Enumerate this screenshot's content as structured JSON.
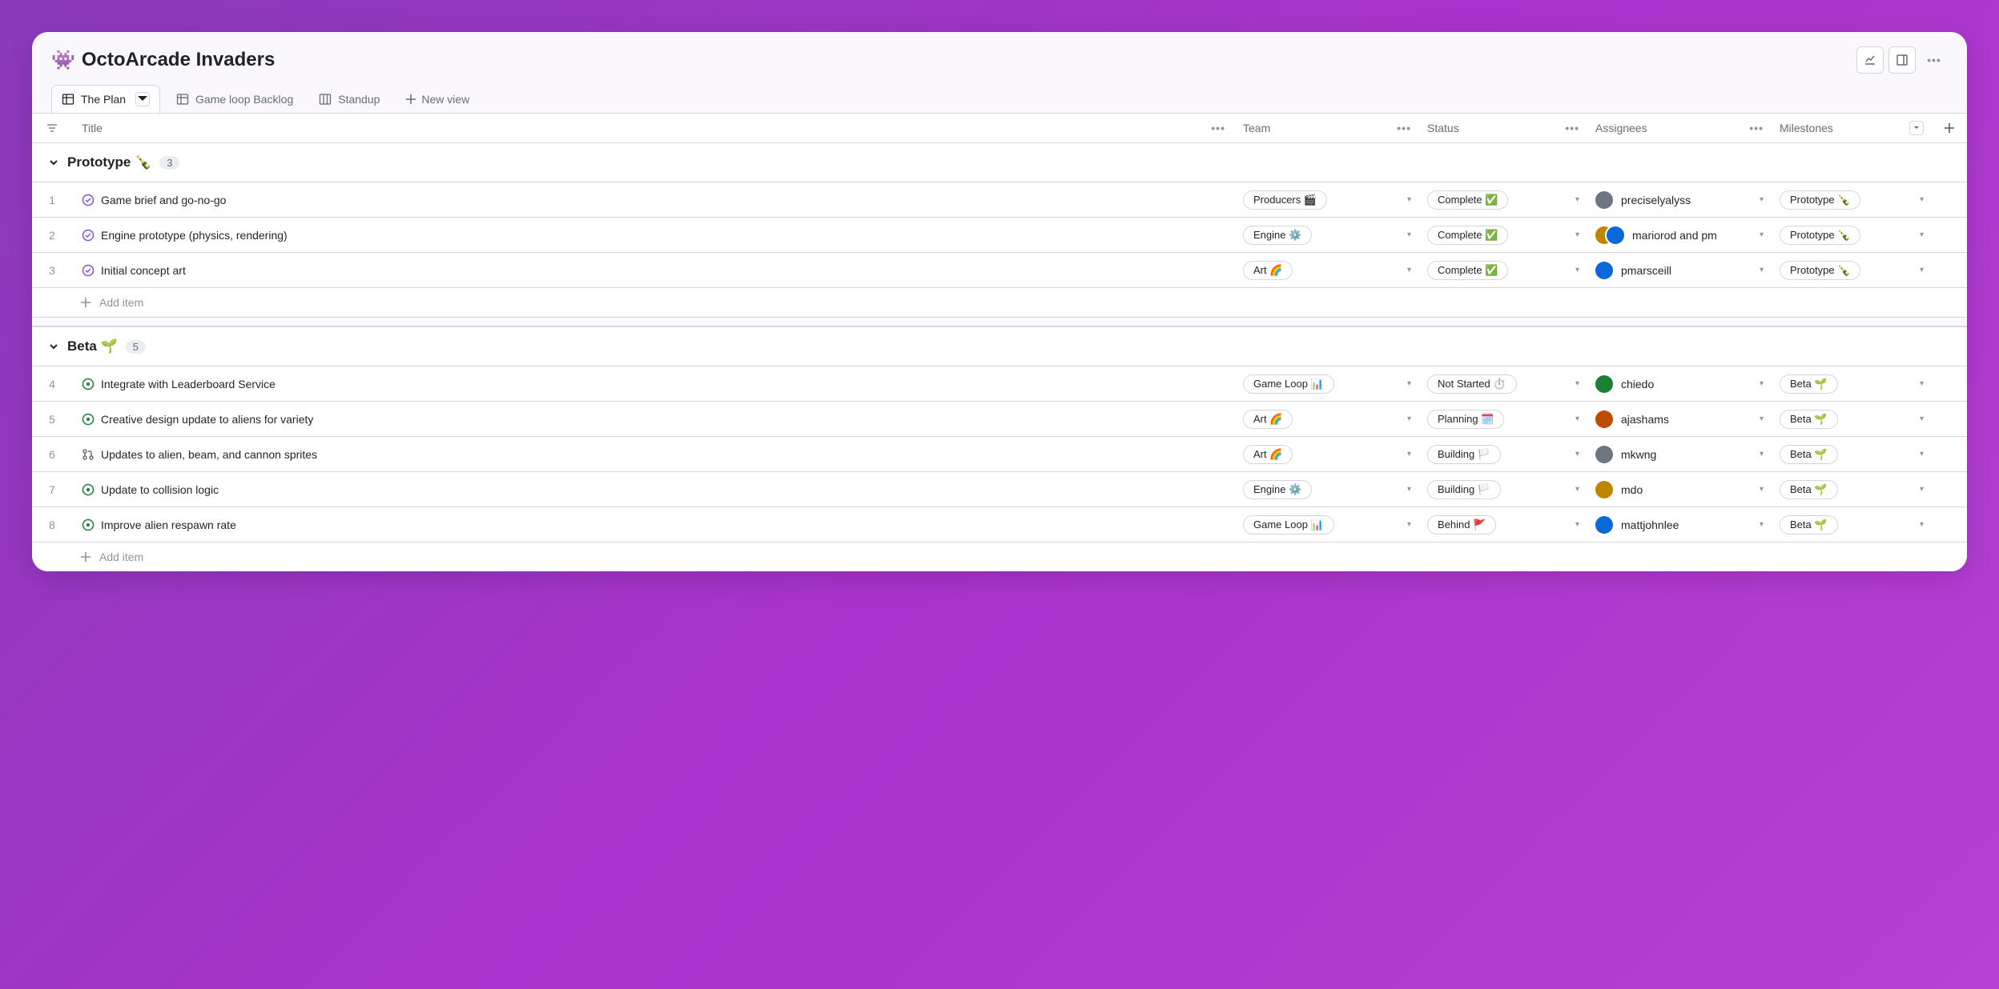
{
  "project": {
    "emoji": "👾",
    "title": "OctoArcade Invaders"
  },
  "tabs": [
    {
      "label": "The Plan",
      "active": true,
      "icon": "table"
    },
    {
      "label": "Game loop Backlog",
      "active": false,
      "icon": "table"
    },
    {
      "label": "Standup",
      "active": false,
      "icon": "board"
    }
  ],
  "new_view_label": "New view",
  "columns": {
    "title": "Title",
    "team": "Team",
    "status": "Status",
    "assignees": "Assignees",
    "milestones": "Milestones"
  },
  "add_item_label": "Add item",
  "groups": [
    {
      "name": "Prototype 🍾",
      "count": "3",
      "rows": [
        {
          "num": "1",
          "state": "done",
          "title": "Game brief and go-no-go",
          "team": "Producers 🎬",
          "status": "Complete ✅",
          "assignees": "preciselyalyss",
          "assignee_count": 1,
          "milestone": "Prototype 🍾"
        },
        {
          "num": "2",
          "state": "done",
          "title": "Engine prototype (physics, rendering)",
          "team": "Engine ⚙️",
          "status": "Complete ✅",
          "assignees": "mariorod and pm",
          "assignee_count": 2,
          "milestone": "Prototype 🍾"
        },
        {
          "num": "3",
          "state": "done",
          "title": "Initial concept art",
          "team": "Art 🌈",
          "status": "Complete ✅",
          "assignees": "pmarsceill",
          "assignee_count": 1,
          "milestone": "Prototype 🍾"
        }
      ]
    },
    {
      "name": "Beta 🌱",
      "count": "5",
      "rows": [
        {
          "num": "4",
          "state": "open",
          "title": "Integrate with Leaderboard Service",
          "team": "Game Loop 📊",
          "status": "Not Started ⏱️",
          "assignees": "chiedo",
          "assignee_count": 1,
          "milestone": "Beta 🌱"
        },
        {
          "num": "5",
          "state": "open",
          "title": "Creative design update to aliens for variety",
          "team": "Art 🌈",
          "status": "Planning 🗓️",
          "assignees": "ajashams",
          "assignee_count": 1,
          "milestone": "Beta 🌱"
        },
        {
          "num": "6",
          "state": "pr",
          "title": "Updates to alien, beam, and cannon sprites",
          "team": "Art 🌈",
          "status": "Building 🏳️",
          "assignees": "mkwng",
          "assignee_count": 1,
          "milestone": "Beta 🌱"
        },
        {
          "num": "7",
          "state": "open",
          "title": "Update to collision logic",
          "team": "Engine ⚙️",
          "status": "Building 🏳️",
          "assignees": "mdo",
          "assignee_count": 1,
          "milestone": "Beta 🌱"
        },
        {
          "num": "8",
          "state": "open",
          "title": "Improve alien respawn rate",
          "team": "Game Loop 📊",
          "status": "Behind 🚩",
          "assignees": "mattjohnlee",
          "assignee_count": 1,
          "milestone": "Beta 🌱"
        }
      ]
    }
  ]
}
